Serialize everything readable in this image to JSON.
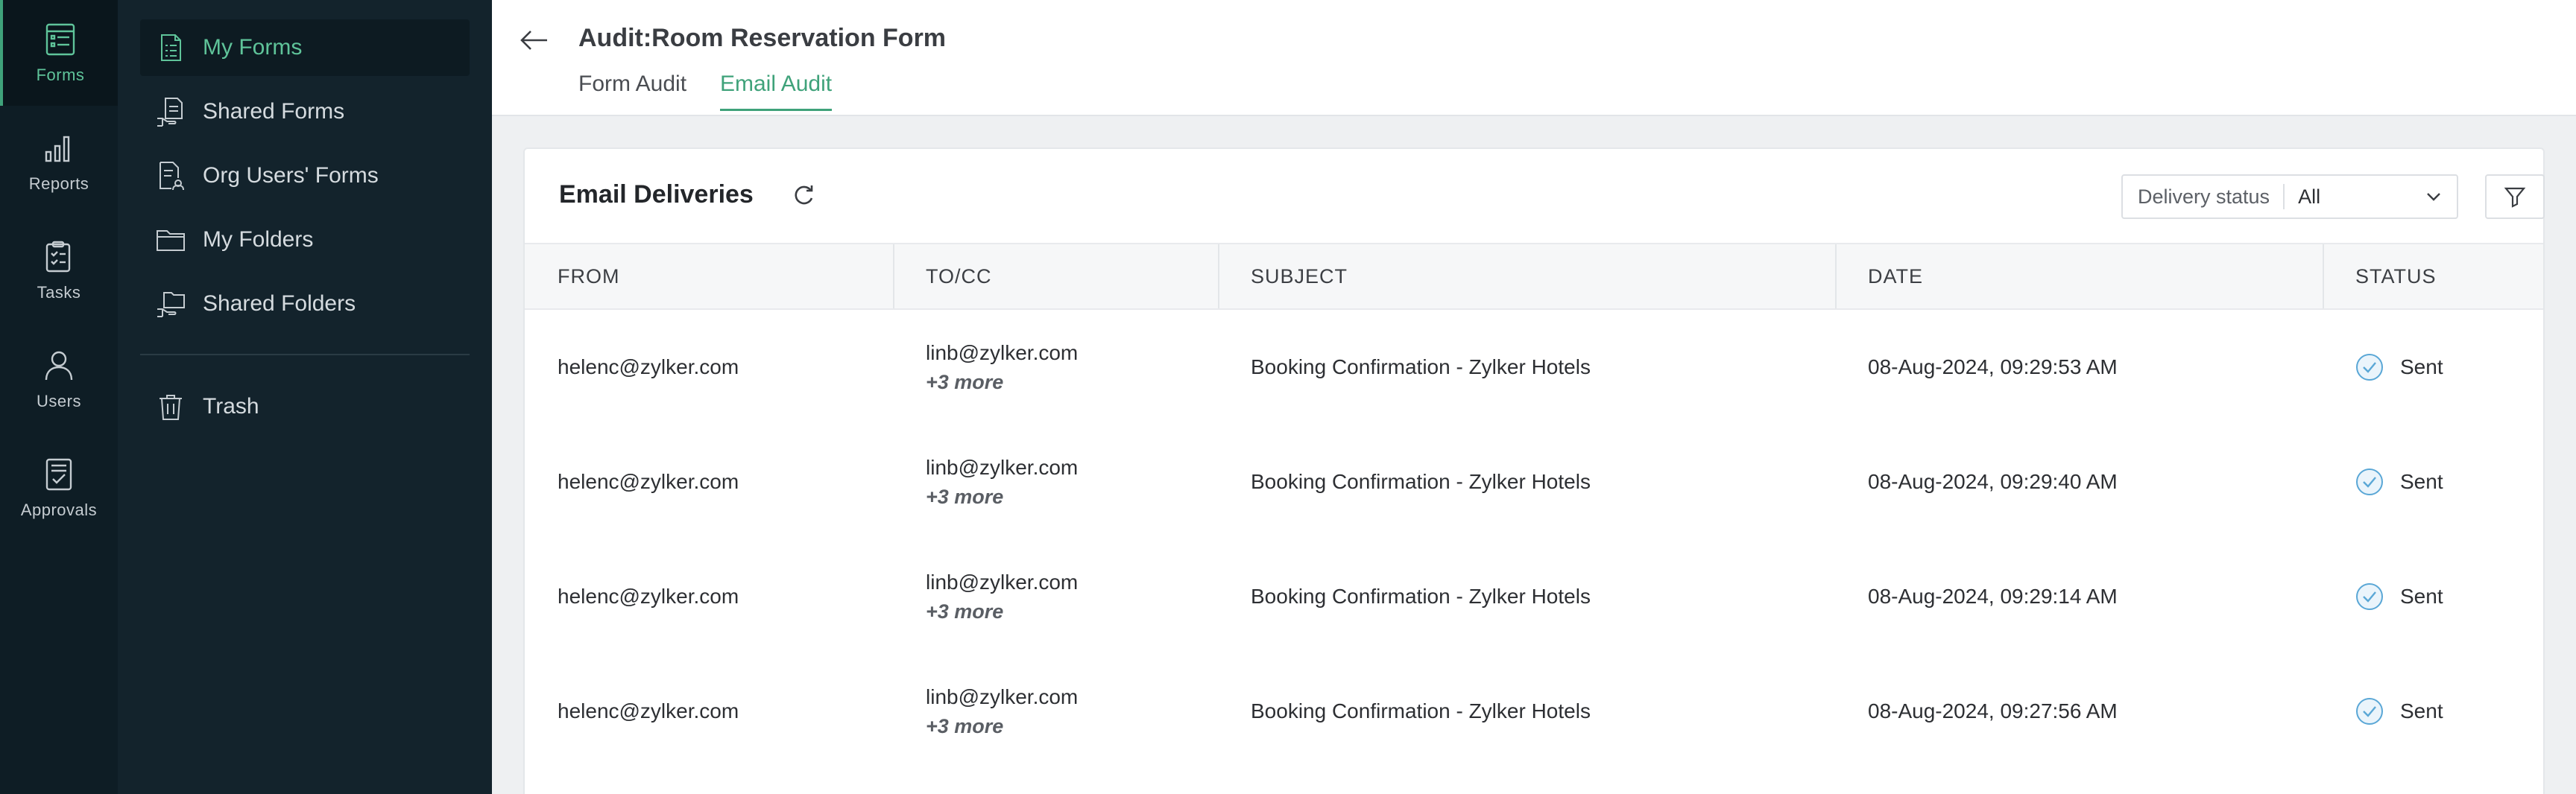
{
  "rail": {
    "items": [
      {
        "label": "Forms",
        "icon": "forms-icon",
        "active": true
      },
      {
        "label": "Reports",
        "icon": "reports-icon"
      },
      {
        "label": "Tasks",
        "icon": "tasks-icon"
      },
      {
        "label": "Users",
        "icon": "users-icon"
      },
      {
        "label": "Approvals",
        "icon": "approvals-icon"
      }
    ]
  },
  "nav": {
    "items": [
      {
        "label": "My Forms",
        "icon": "my-forms-icon",
        "active": true
      },
      {
        "label": "Shared Forms",
        "icon": "shared-forms-icon"
      },
      {
        "label": "Org Users' Forms",
        "icon": "org-users-forms-icon"
      },
      {
        "label": "My Folders",
        "icon": "folder-icon"
      },
      {
        "label": "Shared Folders",
        "icon": "shared-folder-icon"
      },
      {
        "label": "Trash",
        "icon": "trash-icon"
      }
    ]
  },
  "header": {
    "title": "Audit:Room Reservation Form",
    "tabs": [
      {
        "label": "Form Audit",
        "active": false
      },
      {
        "label": "Email Audit",
        "active": true
      }
    ]
  },
  "card": {
    "title": "Email Deliveries",
    "delivery_status_label": "Delivery status",
    "delivery_status_value": "All"
  },
  "table": {
    "columns": [
      "FROM",
      "TO/CC",
      "SUBJECT",
      "DATE",
      "STATUS"
    ],
    "rows": [
      {
        "from": "helenc@zylker.com",
        "to": "linb@zylker.com",
        "more": "+3 more",
        "subject": "Booking Confirmation - Zylker Hotels",
        "date": "08-Aug-2024, 09:29:53 AM",
        "status": "Sent"
      },
      {
        "from": "helenc@zylker.com",
        "to": "linb@zylker.com",
        "more": "+3 more",
        "subject": "Booking Confirmation - Zylker Hotels",
        "date": "08-Aug-2024, 09:29:40 AM",
        "status": "Sent"
      },
      {
        "from": "helenc@zylker.com",
        "to": "linb@zylker.com",
        "more": "+3 more",
        "subject": "Booking Confirmation - Zylker Hotels",
        "date": "08-Aug-2024, 09:29:14 AM",
        "status": "Sent"
      },
      {
        "from": "helenc@zylker.com",
        "to": "linb@zylker.com",
        "more": "+3 more",
        "subject": "Booking Confirmation - Zylker Hotels",
        "date": "08-Aug-2024, 09:27:56 AM",
        "status": "Sent"
      }
    ]
  },
  "colors": {
    "accent": "#3fa27a",
    "rail_bg": "#0e1d25",
    "nav_bg": "#13232c",
    "sent_icon": "#5aa7d6"
  }
}
